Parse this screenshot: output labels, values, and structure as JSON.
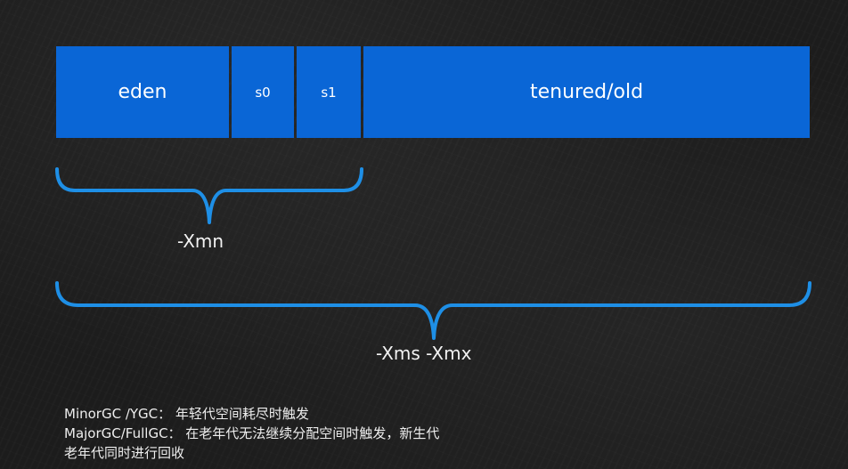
{
  "heap": {
    "regions": {
      "eden": "eden",
      "s0": "s0",
      "s1": "s1",
      "old": "tenured/old"
    }
  },
  "braces": {
    "young_label": "-Xmn",
    "heap_label": "-Xms -Xmx"
  },
  "notes": {
    "line1": "MinorGC /YGC： 年轻代空间耗尽时触发",
    "line2": "MajorGC/FullGC： 在老年代无法继续分配空间时触发，新生代",
    "line3": "老年代同时进行回收"
  },
  "colors": {
    "region_fill": "#0a66d6",
    "brace": "#1e8fe6",
    "background": "#1c1c1c"
  }
}
